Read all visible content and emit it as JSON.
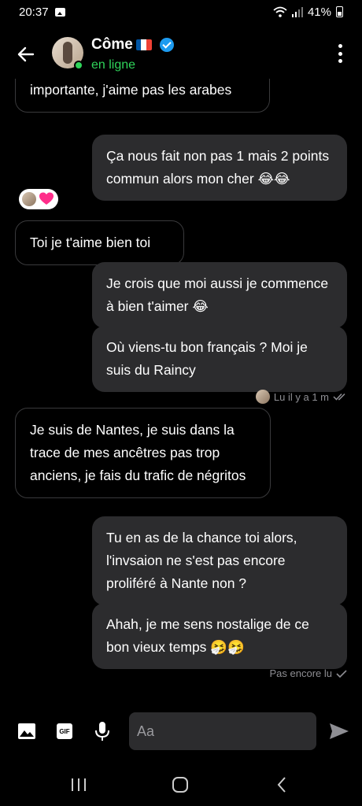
{
  "status_bar": {
    "time": "20:37",
    "battery": "41%"
  },
  "header": {
    "contact_name": "Côme",
    "contact_status": "en ligne"
  },
  "messages": [
    {
      "text": "importante, j'aime pas les arabes"
    },
    {
      "text": "Ça nous fait non pas 1 mais 2 points commun alors mon cher 😂😂"
    },
    {
      "text": "Toi je t'aime bien toi"
    },
    {
      "text": "Je crois que moi aussi je commence à bien t'aimer 😂"
    },
    {
      "text": "Où viens-tu bon français ? Moi je suis du Raincy"
    },
    {
      "text": "Je suis de Nantes, je suis dans la trace de mes ancêtres pas trop anciens, je fais du trafic de négritos"
    },
    {
      "text": "Tu en as de la chance toi alors, l'invsaion ne s'est pas encore proliféré à Nante non ?"
    },
    {
      "text": "Ahah, je me sens nostalige de ce bon vieux temps 🤧🤧"
    }
  ],
  "read_receipt": "Lu il y a 1 m",
  "unread_receipt": "Pas encore lu",
  "composer": {
    "placeholder": "Aa",
    "gif_label": "GIF"
  },
  "colors": {
    "online": "#2fd45a",
    "verified": "#1d9bf0",
    "sent_bubble": "#2c2c2e",
    "reaction_heart": "#ff2d8a"
  }
}
